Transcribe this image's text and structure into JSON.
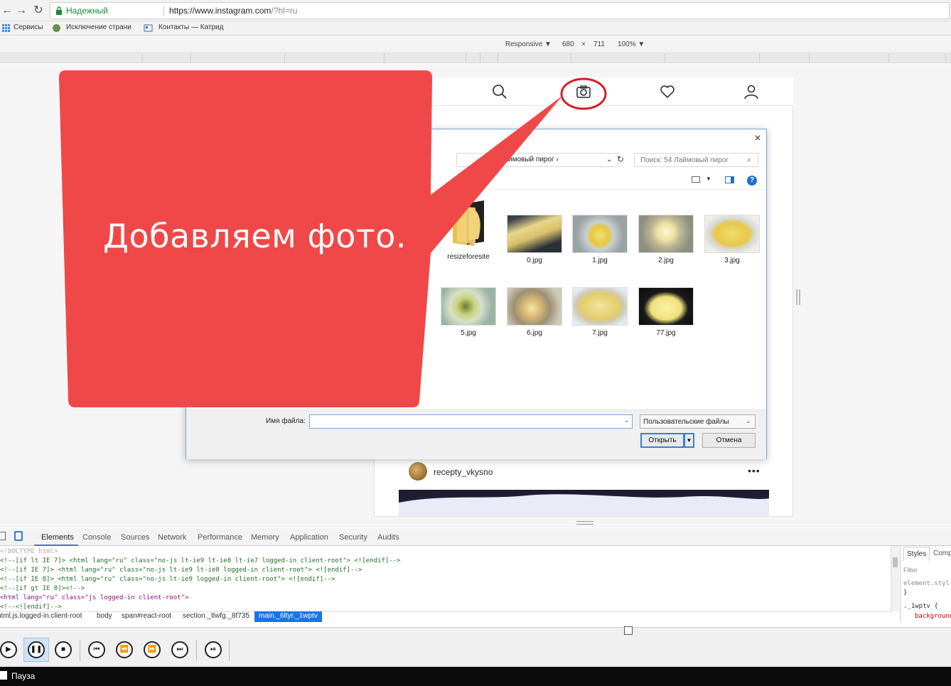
{
  "browser": {
    "secure_label": "Надежный",
    "url_main": "https://www.instagram.com",
    "url_path": "/?hl=ru",
    "bookmarks": [
      "Сервисы",
      "Исключение страни",
      "Контакты — Катрид"
    ]
  },
  "device_toolbar": {
    "mode": "Responsive ▼",
    "width": "680",
    "times": "×",
    "height": "711",
    "zoom": "100% ▼"
  },
  "callout": {
    "text": "Добавляем фото.",
    "color": "#f04848"
  },
  "file_dialog": {
    "path_crumb": "54 Лаймовый пирог",
    "search_placeholder": "Поиск: 54 Лаймовый пирог",
    "files": [
      {
        "name": "resizeforesite",
        "kind": "folder"
      },
      {
        "name": "0.jpg",
        "kind": "image"
      },
      {
        "name": "1.jpg",
        "kind": "image"
      },
      {
        "name": "2.jpg",
        "kind": "image"
      },
      {
        "name": "3.jpg",
        "kind": "image"
      },
      {
        "name": "5.jpg",
        "kind": "image"
      },
      {
        "name": "6.jpg",
        "kind": "image"
      },
      {
        "name": "7.jpg",
        "kind": "image"
      },
      {
        "name": "77.jpg",
        "kind": "image"
      }
    ],
    "filename_label": "Имя файла:",
    "filename_value": "",
    "filetype": "Пользовательские файлы",
    "open_button": "Открыть",
    "cancel_button": "Отмена"
  },
  "post": {
    "username": "recepty_vkysno",
    "more": "•••"
  },
  "devtools": {
    "tabs": [
      "Elements",
      "Console",
      "Sources",
      "Network",
      "Performance",
      "Memory",
      "Application",
      "Security",
      "Audits"
    ],
    "code_lines": [
      "<!DOCTYPE html>",
      "<!--[if lt IE 7]>      <html lang=\"ru\" class=\"no-js lt-ie9 lt-ie8 lt-ie7 logged-in client-root\"> <![endif]-->",
      "<!--[if IE 7]>         <html lang=\"ru\" class=\"no-js lt-ie9 lt-ie8 logged-in client-root\"> <![endif]-->",
      "<!--[if IE 8]>         <html lang=\"ru\" class=\"no-js lt-ie9 logged-in client-root\"> <![endif]-->",
      "<!--[if gt IE 8]><!-->",
      "<html lang=\"ru\" class=\"js logged-in client-root\">",
      "  <!--<![endif]-->"
    ],
    "crumbs": [
      "html.js.logged-in.client-root",
      "body",
      "span#react-root",
      "section._tlwfg._8f735"
    ],
    "crumb_active": "main._6ltyr._1wptv",
    "side_tabs": [
      "Styles",
      "Comp"
    ],
    "side_filter": "Filter",
    "side_lines": [
      "element.styl",
      "}",
      "._1wptv {",
      "background"
    ]
  },
  "taskbar": {
    "label": "Пауза"
  }
}
